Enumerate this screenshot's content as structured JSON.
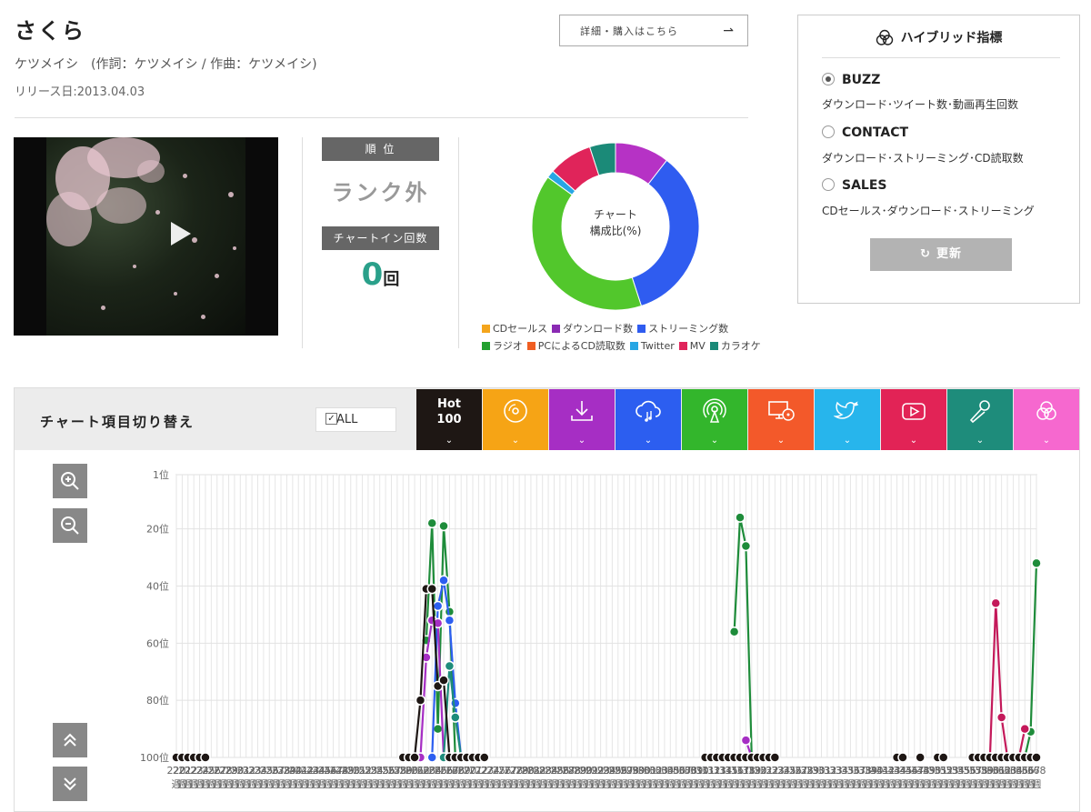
{
  "song": {
    "title": "さくら",
    "artist_line": "ケツメイシ　(作詞：ケツメイシ / 作曲：ケツメイシ)",
    "release": "リリース日:2013.04.03",
    "detail_button": "詳細・購入はこちら",
    "detail_arrow": "⇀"
  },
  "rank": {
    "label": "順 位",
    "value": "ランク外",
    "chartin_label": "チャートイン回数",
    "chartin_value": "0",
    "chartin_unit": "回"
  },
  "donut": {
    "center_line1": "チャート",
    "center_line2": "構成比(%)",
    "segments": [
      {
        "name": "ダウンロード数",
        "value": 10.5,
        "color": "#b632c5"
      },
      {
        "name": "ストリーミング数",
        "value": 34.5,
        "color": "#2f5cf0"
      },
      {
        "name": "ラジオ",
        "value": 40,
        "color": "#52c72c"
      },
      {
        "name": "Twitter",
        "value": 1.5,
        "color": "#27a6e4"
      },
      {
        "name": "MV",
        "value": 8.5,
        "color": "#e0245a"
      },
      {
        "name": "カラオケ",
        "value": 5,
        "color": "#1b8a78"
      }
    ],
    "legend": [
      {
        "label": "CDセールス",
        "color": "#f4a51c"
      },
      {
        "label": "ダウンロード数",
        "color": "#8a2ab3"
      },
      {
        "label": "ストリーミング数",
        "color": "#2f5cf0"
      },
      {
        "label": "ラジオ",
        "color": "#23a030"
      },
      {
        "label": "PCによるCD読取数",
        "color": "#f05e22"
      },
      {
        "label": "Twitter",
        "color": "#27a6e4"
      },
      {
        "label": "MV",
        "color": "#e0245a"
      },
      {
        "label": "カラオケ",
        "color": "#1b8a78"
      }
    ]
  },
  "hybrid": {
    "title": "ハイブリッド指標",
    "options": [
      {
        "label": "BUZZ",
        "desc": "ダウンロード･ツイート数･動画再生回数",
        "selected": true
      },
      {
        "label": "CONTACT",
        "desc": "ダウンロード･ストリーミング･CD読取数",
        "selected": false
      },
      {
        "label": "SALES",
        "desc": "CDセールス･ダウンロード･ストリーミング",
        "selected": false
      }
    ],
    "update_label": "更新"
  },
  "switcher": {
    "title": "チャート項目切り替え",
    "all_label": "ALL",
    "hot_line1": "Hot",
    "hot_line2": "100",
    "tabs": [
      {
        "icon": "hot100",
        "color": "#1e1714"
      },
      {
        "icon": "cd-icon",
        "color": "#f6a415"
      },
      {
        "icon": "download-icon",
        "color": "#a62ec4"
      },
      {
        "icon": "streaming-icon",
        "color": "#2c5ef0"
      },
      {
        "icon": "radio-icon",
        "color": "#33b62c"
      },
      {
        "icon": "pc-cd-icon",
        "color": "#f3592a"
      },
      {
        "icon": "twitter-icon",
        "color": "#27b5ec"
      },
      {
        "icon": "youtube-icon",
        "color": "#e22356"
      },
      {
        "icon": "karaoke-icon",
        "color": "#1e8c7b"
      },
      {
        "icon": "hybrid-icon",
        "color": "#f668cf"
      }
    ]
  },
  "chart_data": {
    "type": "line",
    "ylabel_ticks": [
      "1位",
      "20位",
      "40位",
      "60位",
      "80位",
      "100位"
    ],
    "ylim": [
      1,
      100
    ],
    "y_inverted": true,
    "x_ticks": [
      "220週",
      "221週",
      "222週",
      "223週",
      "224週",
      "225週",
      "226週",
      "227週",
      "228週",
      "229週",
      "230週",
      "231週",
      "232週",
      "233週",
      "234週",
      "235週",
      "236週",
      "237週",
      "238週",
      "239週",
      "240週",
      "241週",
      "242週",
      "243週",
      "244週",
      "245週",
      "246週",
      "247週",
      "248週",
      "249週",
      "250週",
      "251週",
      "252週",
      "253週",
      "254週",
      "255週",
      "256週",
      "257週",
      "258週",
      "259週",
      "260週",
      "261週",
      "262週",
      "263週",
      "264週",
      "265週",
      "266週",
      "267週",
      "268週",
      "269週",
      "270週",
      "271週",
      "272週",
      "273週",
      "274週",
      "275週",
      "276週",
      "277週",
      "278週",
      "279週",
      "280週",
      "281週",
      "282週",
      "283週",
      "284週",
      "285週",
      "286週",
      "287週",
      "288週",
      "289週",
      "290週",
      "291週",
      "292週",
      "293週",
      "294週",
      "295週",
      "296週",
      "297週",
      "298週",
      "299週",
      "300週",
      "301週",
      "302週",
      "303週",
      "304週",
      "305週",
      "306週",
      "307週",
      "308週",
      "309週",
      "310週",
      "311週",
      "312週",
      "313週",
      "314週",
      "315週",
      "316週",
      "317週",
      "318週",
      "319週",
      "320週",
      "321週",
      "322週",
      "323週",
      "324週",
      "325週",
      "326週",
      "327週",
      "328週",
      "329週",
      "330週",
      "331週",
      "332週",
      "333週",
      "334週",
      "335週",
      "336週",
      "337週",
      "338週",
      "339週",
      "340週",
      "341週",
      "342週",
      "343週",
      "344週",
      "345週",
      "346週",
      "347週",
      "348週",
      "349週",
      "350週",
      "351週",
      "352週",
      "353週",
      "354週",
      "355週",
      "356週",
      "357週",
      "358週",
      "359週",
      "360週",
      "361週",
      "362週",
      "363週",
      "364週",
      "365週",
      "366週",
      "367週",
      "368週"
    ],
    "x_range": [
      220,
      368
    ],
    "grid": true,
    "series": [
      {
        "color": "#1e8c3a",
        "points": [
          [
            263,
            59
          ],
          [
            264,
            18
          ],
          [
            265,
            90
          ],
          [
            266,
            19
          ],
          [
            267,
            49
          ],
          [
            268,
            100
          ],
          [
            316,
            56
          ],
          [
            317,
            16
          ],
          [
            318,
            26
          ],
          [
            319,
            100
          ],
          [
            366,
            100
          ],
          [
            367,
            91
          ],
          [
            368,
            32
          ]
        ]
      },
      {
        "color": "#2c5ef0",
        "points": [
          [
            264,
            100
          ],
          [
            265,
            47
          ],
          [
            266,
            38
          ],
          [
            267,
            52
          ],
          [
            268,
            81
          ],
          [
            269,
            100
          ]
        ]
      },
      {
        "color": "#a62ec4",
        "points": [
          [
            262,
            100
          ],
          [
            263,
            65
          ],
          [
            264,
            52
          ],
          [
            265,
            53
          ],
          [
            266,
            100
          ],
          [
            318,
            94
          ],
          [
            319,
            100
          ]
        ]
      },
      {
        "color": "#c4195a",
        "points": [
          [
            360,
            100
          ],
          [
            361,
            46
          ],
          [
            362,
            86
          ],
          [
            363,
            100
          ],
          [
            365,
            100
          ],
          [
            366,
            90
          ]
        ]
      },
      {
        "color": "#1e8c7b",
        "points": [
          [
            266,
            100
          ],
          [
            267,
            68
          ],
          [
            268,
            86
          ],
          [
            269,
            100
          ]
        ]
      },
      {
        "color": "#1e1714",
        "points": [
          [
            220,
            100
          ],
          [
            221,
            100
          ],
          [
            222,
            100
          ],
          [
            223,
            100
          ],
          [
            224,
            100
          ],
          [
            225,
            100
          ],
          [
            259,
            100
          ],
          [
            260,
            100
          ],
          [
            261,
            100
          ],
          [
            262,
            80
          ],
          [
            263,
            41
          ],
          [
            264,
            41
          ],
          [
            265,
            75
          ],
          [
            266,
            73
          ],
          [
            267,
            100
          ],
          [
            268,
            100
          ],
          [
            269,
            100
          ],
          [
            270,
            100
          ],
          [
            271,
            100
          ],
          [
            272,
            100
          ],
          [
            273,
            100
          ],
          [
            311,
            100
          ],
          [
            312,
            100
          ],
          [
            313,
            100
          ],
          [
            314,
            100
          ],
          [
            315,
            100
          ],
          [
            316,
            100
          ],
          [
            317,
            100
          ],
          [
            318,
            100
          ],
          [
            319,
            100
          ],
          [
            320,
            100
          ],
          [
            321,
            100
          ],
          [
            322,
            100
          ],
          [
            323,
            100
          ],
          [
            344,
            100
          ],
          [
            345,
            100
          ],
          [
            348,
            100
          ],
          [
            351,
            100
          ],
          [
            352,
            100
          ],
          [
            357,
            100
          ],
          [
            358,
            100
          ],
          [
            359,
            100
          ],
          [
            360,
            100
          ],
          [
            361,
            100
          ],
          [
            362,
            100
          ],
          [
            363,
            100
          ],
          [
            364,
            100
          ],
          [
            365,
            100
          ],
          [
            366,
            100
          ],
          [
            367,
            100
          ],
          [
            368,
            100
          ]
        ]
      }
    ]
  }
}
